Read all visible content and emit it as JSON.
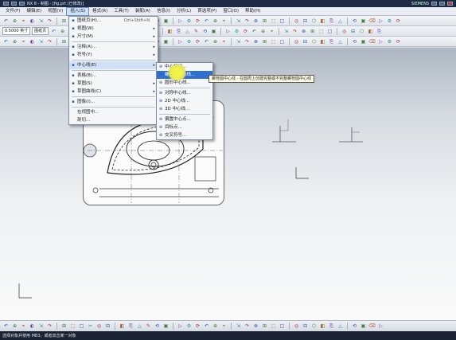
{
  "window": {
    "title": "NX 8 - 制图 - [fig.prt (已修改)]",
    "right_text": "SIEMENS"
  },
  "menubar": {
    "items": [
      "文件(F)",
      "编辑(E)",
      "视图(V)",
      "插入(S)",
      "格式(R)",
      "工具(T)",
      "装配(A)",
      "信息(I)",
      "分析(L)",
      "首选项(P)",
      "窗口(O)",
      "帮助(H)"
    ],
    "active_index": 3
  },
  "toolbar2": {
    "combo1": "0.5000 英寸",
    "combo2": "图纸页"
  },
  "insert_menu": {
    "items": [
      {
        "label": "图纸页(H)...",
        "shortcut": "Ctrl+Shift+N",
        "icon": "sheet-icon",
        "submenu": false
      },
      {
        "label": "视图(W)",
        "shortcut": "",
        "icon": "view-icon",
        "submenu": true
      },
      {
        "label": "尺寸(M)",
        "shortcut": "",
        "icon": "dimension-icon",
        "submenu": true
      },
      {
        "sep": true
      },
      {
        "label": "注释(A)...",
        "shortcut": "",
        "icon": "note-icon",
        "submenu": true
      },
      {
        "label": "符号(Y)",
        "shortcut": "",
        "icon": "symbol-icon",
        "submenu": true
      },
      {
        "sep": true
      },
      {
        "label": "中心线(E)",
        "shortcut": "",
        "icon": "centerline-icon",
        "submenu": true,
        "highlight": true
      },
      {
        "sep": true
      },
      {
        "label": "表格(B)...",
        "shortcut": "",
        "icon": "table-icon",
        "submenu": false
      },
      {
        "label": "草图(S)",
        "shortcut": "",
        "icon": "sketch-icon",
        "submenu": true
      },
      {
        "label": "草图曲线(C)",
        "shortcut": "",
        "icon": "curve-icon",
        "submenu": true
      },
      {
        "sep": true
      },
      {
        "label": "图像(I)...",
        "shortcut": "",
        "icon": "image-icon",
        "submenu": false
      },
      {
        "sep": true
      },
      {
        "label": "在视图中...",
        "shortcut": "",
        "icon": "none",
        "submenu": false
      },
      {
        "label": "剖切...",
        "shortcut": "",
        "icon": "none",
        "submenu": false
      }
    ]
  },
  "centerline_submenu": {
    "items": [
      {
        "label": "中心标记...",
        "icon": "center-mark-icon",
        "highlight": false
      },
      {
        "label": "螺栓圆中心线...",
        "icon": "bolt-circle-icon",
        "highlight": true
      },
      {
        "label": "圆形中心线...",
        "icon": "circle-centerline-icon",
        "highlight": false
      },
      {
        "sep": true
      },
      {
        "label": "对称中心线...",
        "icon": "symmetric-icon",
        "highlight": false
      },
      {
        "label": "2D 中心线...",
        "icon": "centerline-2d-icon",
        "highlight": false
      },
      {
        "label": "3D 中心线...",
        "icon": "centerline-3d-icon",
        "highlight": false
      },
      {
        "sep": true
      },
      {
        "label": "偏置中心点...",
        "icon": "offset-center-icon",
        "highlight": false
      },
      {
        "label": "目标点...",
        "icon": "target-point-icon",
        "highlight": false
      },
      {
        "label": "交叉符号...",
        "icon": "cross-icon",
        "highlight": false
      }
    ]
  },
  "tooltip": "螺栓圆中心线 - 在圆周上创建完整或不完整螺栓圆中心线",
  "statusbar": {
    "text": "选择对象并使用 MB3，或者双击某一对象"
  }
}
